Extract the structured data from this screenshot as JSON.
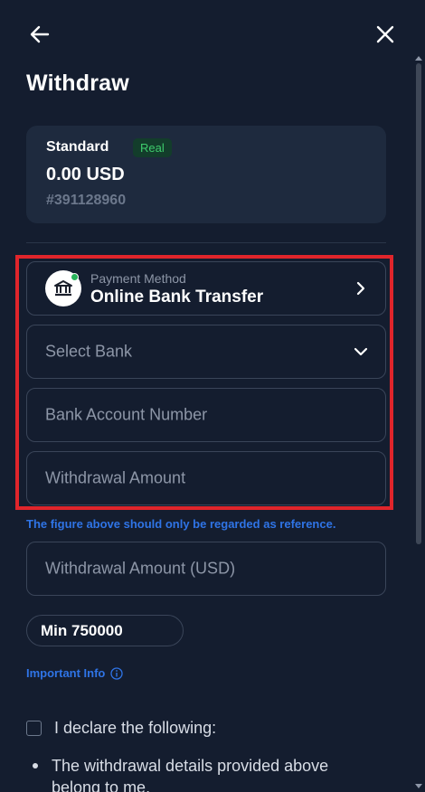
{
  "header": {
    "back_icon": "arrow-left-icon",
    "close_icon": "close-icon",
    "title": "Withdraw"
  },
  "account": {
    "type": "Standard",
    "badge": "Real",
    "balance": "0.00 USD",
    "id": "#391128960"
  },
  "form": {
    "payment_method_label": "Payment Method",
    "payment_method_value": "Online Bank Transfer",
    "payment_method_icon": "bank-icon",
    "select_bank_placeholder": "Select Bank",
    "account_number_placeholder": "Bank Account Number",
    "withdrawal_amount_placeholder": "Withdrawal Amount",
    "reference_note": "The figure above should only be regarded as reference.",
    "withdrawal_amount_usd_placeholder": "Withdrawal Amount (USD)",
    "min_amount": "Min 750000",
    "important_info": "Important Info"
  },
  "declaration": {
    "text": "I declare the following:",
    "items": [
      "The withdrawal details provided above belong to me."
    ]
  },
  "colors": {
    "background": "#141d2f",
    "card": "#1e2a3e",
    "accent_blue": "#2f74e6",
    "badge_green": "#3ecb6c",
    "highlight_red": "#e0252b"
  }
}
